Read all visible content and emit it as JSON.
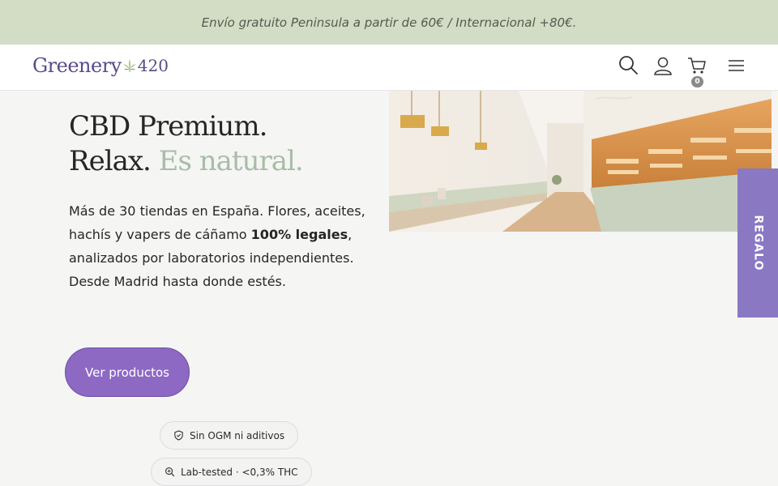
{
  "promo": {
    "text": "Envío gratuito Peninsula a partir de 60€ / Internacional +80€."
  },
  "header": {
    "logo_word": "Greenery",
    "logo_number": "420",
    "icons": [
      "search-icon",
      "user-icon",
      "cart-icon",
      "menu-icon"
    ],
    "cart_count": "0"
  },
  "hero": {
    "title_line1": "CBD Premium.",
    "title_line2_start": "Relax.",
    "title_line2_accent": "Es natural.",
    "desc_part1": "Más de 30 tiendas en España. Flores, aceites, hachís y vapers de cáñamo ",
    "desc_bold": "100% legales",
    "desc_part2": ", analizados por laboratorios independientes. Desde Madrid hasta donde estés.",
    "cta_label": "Ver productos"
  },
  "badges": [
    {
      "icon": "shield-check-icon",
      "label": "Sin OGM ni aditivos"
    },
    {
      "icon": "magnifier-icon",
      "label": "Lab-tested · <0,3% THC"
    }
  ],
  "gift_tab": {
    "label": "REGALO"
  },
  "colors": {
    "promo_bg": "#d3dcc4",
    "brand_purple": "#5a4a8a",
    "cta": "#8d69c3",
    "accent_green": "#a9bca7",
    "gift_tab": "#8a78c3"
  }
}
